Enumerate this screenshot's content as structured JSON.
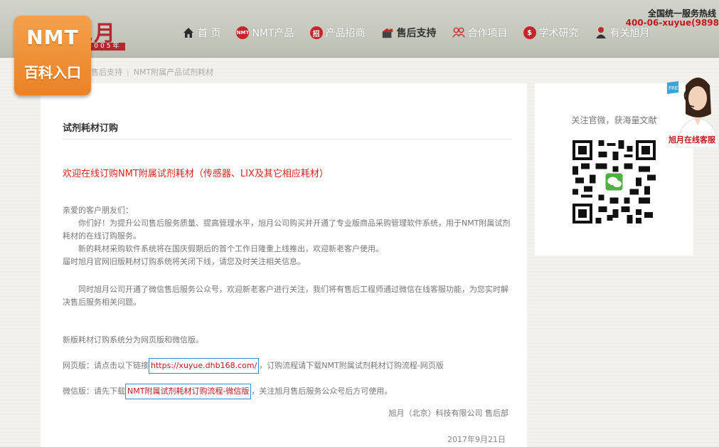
{
  "header": {
    "logo_text": "旭月",
    "logo_year": "2005年",
    "nav": [
      {
        "label": "首 页",
        "icon": "home-icon"
      },
      {
        "label": "NMT产品",
        "icon": "nmt-icon"
      },
      {
        "label": "产品招商",
        "icon": "recruit-icon"
      },
      {
        "label": "售后支持",
        "icon": "support-icon"
      },
      {
        "label": "合作项目",
        "icon": "partner-icon"
      },
      {
        "label": "学术研究",
        "icon": "research-icon"
      },
      {
        "label": "有关旭月",
        "icon": "about-icon"
      }
    ],
    "hotline_label": "全国统一服务热线",
    "hotline_number": "400-06-xuyue(9898"
  },
  "badge": {
    "top": "NMT",
    "bottom": "百科入口"
  },
  "breadcrumb": {
    "current": "售后支持",
    "page": "NMT附属产品试剂耗材"
  },
  "content": {
    "title": "试剂耗材订购",
    "welcome": "欢迎在线订购NMT附属试剂耗材（传感器、LIX及其它相应耗材）",
    "greeting": "亲爱的客户朋友们：",
    "p1": "你们好！为提升公司售后服务质量、提高管理水平，旭月公司购买并开通了专业版商品采购管理软件系统，用于NMT附属试剂耗材的在线订购服务。",
    "p2": "新的耗材采购软件系统将在国庆假期后的首个工作日隆重上线推出，欢迎新老客户使用。",
    "p3": "届时旭月官网旧版耗材订购系统将关闭下线，请您及时关注相关信息。",
    "p4": "同时旭月公司开通了微信售后服务公众号，欢迎新老客户进行关注，我们将有售后工程师通过微信在线客服功能，为您实时解决售后服务相关问题。",
    "p5": "新版耗材订购系统分为网页版和微信版。",
    "web_prefix": "网页版：请点击以下链接",
    "web_link": "https://xuyue.dhb168.com/",
    "web_suffix": "，订购流程请下载NMT附属试剂耗材订购流程-网页版",
    "wx_prefix": "微信版：请先下载",
    "wx_link": "NMT附属试剂耗材订购流程-微信版",
    "wx_suffix": "，关注旭月售后服务公众号后方可使用。",
    "signature": "旭月（北京）科技有限公司 售后部",
    "date": "2017年9月21日"
  },
  "side": {
    "title": "关注官微，获海量文献"
  },
  "service": {
    "free_tag": "FREE",
    "label": "旭月在线客服"
  },
  "colors": {
    "brand_red": "#c0181f",
    "badge_orange": "#ee8a2f",
    "link_border": "#3a8cc9"
  }
}
